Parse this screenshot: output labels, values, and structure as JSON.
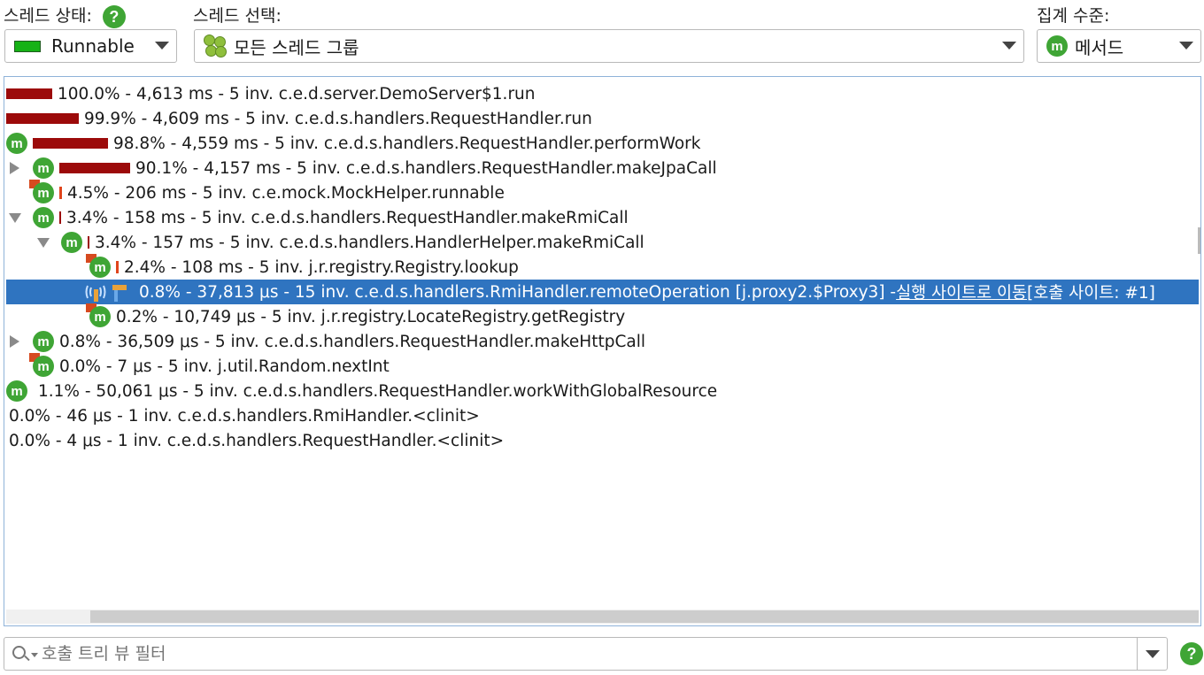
{
  "top_bar": {
    "thread_state_label": "스레드 상태:",
    "thread_state_value": "Runnable",
    "thread_select_label": "스레드 선택:",
    "thread_select_value": "모든 스레드 그룹",
    "aggregation_label": "집계 수준:",
    "aggregation_value": "메서드",
    "aggregation_icon_letter": "m",
    "help_symbol": "?"
  },
  "tree": {
    "rows": [
      {
        "text": "100.0% - 4,613 ms - 5 inv. c.e.d.server.DemoServer$1.run",
        "bar": 1.0
      },
      {
        "text": "99.9% - 4,609 ms - 5 inv. c.e.d.s.handlers.RequestHandler.run",
        "bar": 0.999
      },
      {
        "text": "98.8% - 4,559 ms - 5 inv. c.e.d.s.handlers.RequestHandler.performWork",
        "bar": 0.988
      },
      {
        "text": "90.1% - 4,157 ms - 5 inv. c.e.d.s.handlers.RequestHandler.makeJpaCall",
        "bar": 0.901
      },
      {
        "text": "4.5% - 206 ms - 5 inv. c.e.mock.MockHelper.runnable",
        "bar": 0.045
      },
      {
        "text": "3.4% - 158 ms - 5 inv. c.e.d.s.handlers.RequestHandler.makeRmiCall",
        "bar": 0.034
      },
      {
        "text": "3.4% - 157 ms - 5 inv. c.e.d.s.handlers.HandlerHelper.makeRmiCall",
        "bar": 0.034
      },
      {
        "text": "2.4% - 108 ms - 5 inv. j.r.registry.Registry.lookup",
        "bar": 0.024
      },
      {
        "text": "0.8% - 37,813 μs - 15 inv. c.e.d.s.handlers.RmiHandler.remoteOperation [j.proxy2.$Proxy3] - ",
        "link": "실행 사이트로 이동",
        "suffix": " [호출 사이트: #1]",
        "bar": 0.008
      },
      {
        "text": "0.2% - 10,749 μs - 5 inv. j.r.registry.LocateRegistry.getRegistry",
        "bar": 0.002
      },
      {
        "text": "0.8% - 36,509 μs - 5 inv. c.e.d.s.handlers.RequestHandler.makeHttpCall",
        "bar": 0.008
      },
      {
        "text": "0.0% - 7 μs - 5 inv. j.util.Random.nextInt",
        "bar": 0.0
      },
      {
        "text": "1.1% - 50,061 μs - 5 inv. c.e.d.s.handlers.RequestHandler.workWithGlobalResource",
        "bar": 0.011
      },
      {
        "text": "0.0% - 46 μs - 1 inv. c.e.d.s.handlers.RmiHandler.<clinit>",
        "bar": 0.0
      },
      {
        "text": "0.0% - 4 μs - 1 inv. c.e.d.s.handlers.RequestHandler.<clinit>",
        "bar": 0.0
      }
    ]
  },
  "filter": {
    "placeholder": "호출 트리 뷰 필터"
  }
}
